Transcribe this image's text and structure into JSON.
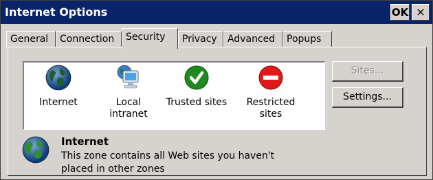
{
  "window": {
    "title": "Internet Options",
    "ok_label": "OK",
    "close_label": "×"
  },
  "tabs": [
    {
      "label": "General",
      "active": false
    },
    {
      "label": "Connection",
      "active": false
    },
    {
      "label": "Security",
      "active": true
    },
    {
      "label": "Privacy",
      "active": false
    },
    {
      "label": "Advanced",
      "active": false
    },
    {
      "label": "Popups",
      "active": false
    }
  ],
  "zones": [
    {
      "label": "Internet",
      "icon": "globe-icon"
    },
    {
      "label": "Local intranet",
      "icon": "computer-globe-icon"
    },
    {
      "label": "Trusted sites",
      "icon": "green-check-icon"
    },
    {
      "label": "Restricted sites",
      "icon": "red-no-entry-icon"
    }
  ],
  "buttons": {
    "sites_label": "Sites...",
    "sites_enabled": false,
    "settings_label": "Settings..."
  },
  "selected_zone": {
    "title": "Internet",
    "description": "This zone contains all Web sites you haven't placed in other zones",
    "icon": "globe-icon"
  },
  "colors": {
    "titlebar": "#0a246a",
    "dialog_bg": "#d6d3ce",
    "check_green": "#1f8a1f",
    "restricted_red": "#e01818"
  }
}
